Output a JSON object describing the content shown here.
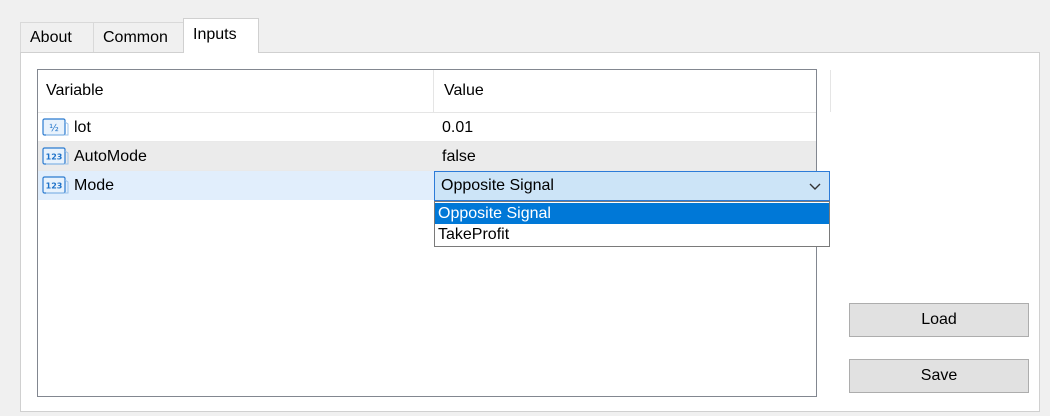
{
  "tabs": [
    "About",
    "Common",
    "Inputs"
  ],
  "active_tab": "Inputs",
  "grid": {
    "headers": {
      "variable": "Variable",
      "value": "Value"
    },
    "rows": [
      {
        "name": "lot",
        "value": "0.01",
        "icon": "fraction-type-icon"
      },
      {
        "name": "AutoMode",
        "value": "false",
        "icon": "integer-type-icon"
      },
      {
        "name": "Mode",
        "value": "Opposite Signal",
        "icon": "integer-type-icon"
      }
    ]
  },
  "dropdown": {
    "options": [
      "Opposite Signal",
      "TakeProfit"
    ],
    "selected": "Opposite Signal"
  },
  "buttons": {
    "load": "Load",
    "save": "Save"
  },
  "icon_glyphs": {
    "fraction": "½",
    "integer": "123"
  },
  "colors": {
    "selection": "#0078d7",
    "row_highlight": "#e1eefc",
    "combo_background": "#cce4f7",
    "icon_blue": "#1e72c9"
  }
}
